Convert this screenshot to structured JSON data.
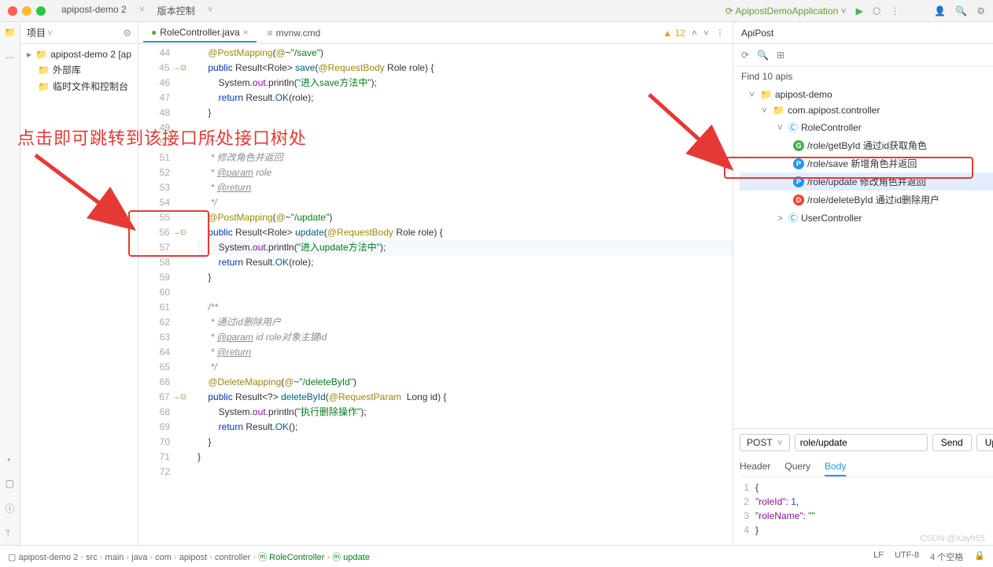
{
  "titlebar": {
    "project": "apipost-demo 2",
    "menu2": "版本控制",
    "run_config": "ApipostDemoApplication"
  },
  "project_panel": {
    "title": "项目",
    "items": [
      {
        "label": "apipost-demo 2 [ap",
        "expandable": true,
        "icon": "folder"
      },
      {
        "label": "外部库",
        "icon": "lib"
      },
      {
        "label": "临时文件和控制台",
        "icon": "scratch"
      }
    ]
  },
  "tabs": {
    "active": "RoleController.java",
    "other": "mvnw.cmd",
    "warnings": "12"
  },
  "code": {
    "lines": [
      {
        "n": 44,
        "html": "    <span class='anno'>@PostMapping</span>(<span class='anno'>@</span>~<span class='str'>\"/save\"</span>)",
        "ind": ""
      },
      {
        "n": 45,
        "html": "    <span class='kw'>public</span> Result&lt;Role&gt; <span class='fn'>save</span>(<span class='anno'>@RequestBody</span> Role role) {",
        "ind": "→⊙"
      },
      {
        "n": 46,
        "html": "        System.<span class='field'>out</span>.println(<span class='str'>\"进入save方法中\"</span>);",
        "ind": ""
      },
      {
        "n": 47,
        "html": "        <span class='kw'>return</span> Result.<span class='fn'>OK</span>(role);",
        "ind": ""
      },
      {
        "n": 48,
        "html": "    }",
        "ind": ""
      },
      {
        "n": 49,
        "html": "",
        "ind": ""
      },
      {
        "n": 50,
        "html": "    <span class='comment'>/**</span>",
        "ind": ""
      },
      {
        "n": 51,
        "html": "    <span class='comment'> * 修改角色并返回</span>",
        "ind": ""
      },
      {
        "n": 52,
        "html": "    <span class='comment'> * <span class='param'>@param</span> role</span>",
        "ind": ""
      },
      {
        "n": 53,
        "html": "    <span class='comment'> * <span class='param'>@return</span></span>",
        "ind": ""
      },
      {
        "n": 54,
        "html": "    <span class='comment'> */</span>",
        "ind": ""
      },
      {
        "n": 55,
        "html": "    <span class='anno'>@PostMapping</span>(<span class='anno'>@</span>~<span class='str'>\"/update\"</span>)",
        "ind": ""
      },
      {
        "n": 56,
        "html": "    <span class='kw'>public</span> Result&lt;Role&gt; <span class='fn'>update</span>(<span class='anno'>@RequestBody</span> Role role) {",
        "ind": "→⊙"
      },
      {
        "n": 57,
        "html": "        System.<span class='field'>out</span>.println(<span class='str'>\"进入update方法中\"</span>);",
        "ind": "",
        "hl": true
      },
      {
        "n": 58,
        "html": "        <span class='kw'>return</span> Result.<span class='fn'>OK</span>(role);",
        "ind": ""
      },
      {
        "n": 59,
        "html": "    }",
        "ind": ""
      },
      {
        "n": 60,
        "html": "",
        "ind": ""
      },
      {
        "n": 61,
        "html": "    <span class='comment'>/**</span>",
        "ind": ""
      },
      {
        "n": 62,
        "html": "    <span class='comment'> * 通过id删除用户</span>",
        "ind": ""
      },
      {
        "n": 63,
        "html": "    <span class='comment'> * <span class='param'>@param</span> id role对象主键id</span>",
        "ind": ""
      },
      {
        "n": 64,
        "html": "    <span class='comment'> * <span class='param'>@return</span></span>",
        "ind": ""
      },
      {
        "n": 65,
        "html": "    <span class='comment'> */</span>",
        "ind": ""
      },
      {
        "n": 66,
        "html": "    <span class='anno'>@DeleteMapping</span>(<span class='anno'>@</span>~<span class='str'>\"/deleteById\"</span>)",
        "ind": ""
      },
      {
        "n": 67,
        "html": "    <span class='kw'>public</span> Result&lt;?&gt; <span class='fn'>deleteById</span>(<span class='anno'>@RequestParam</span>  Long id) {",
        "ind": "→⊙"
      },
      {
        "n": 68,
        "html": "        System.<span class='field'>out</span>.println(<span class='str'>\"执行删除操作\"</span>);",
        "ind": ""
      },
      {
        "n": 69,
        "html": "        <span class='kw'>return</span> Result.<span class='fn'>OK</span>();",
        "ind": ""
      },
      {
        "n": 70,
        "html": "    }",
        "ind": ""
      },
      {
        "n": 71,
        "html": "}",
        "ind": ""
      },
      {
        "n": 72,
        "html": "",
        "ind": ""
      }
    ]
  },
  "apipost": {
    "title": "ApiPost",
    "find_label": "Find 10 apis",
    "tree": [
      {
        "lvl": 1,
        "icon": "folder",
        "label": "apipost-demo",
        "caret": "v"
      },
      {
        "lvl": 2,
        "icon": "folder",
        "label": "com.apipost.controller",
        "caret": "v"
      },
      {
        "lvl": 3,
        "icon": "class",
        "label": "RoleController",
        "caret": "v"
      },
      {
        "lvl": 4,
        "badge": "G",
        "label": "/role/getById  通过id获取角色"
      },
      {
        "lvl": 4,
        "badge": "P",
        "label": "/role/save  新增角色并返回"
      },
      {
        "lvl": 4,
        "badge": "P",
        "label": "/role/update  修改角色并返回",
        "selected": true
      },
      {
        "lvl": 4,
        "badge": "D",
        "label": "/role/deleteById  通过id删除用户"
      },
      {
        "lvl": 3,
        "icon": "class",
        "label": "UserController",
        "caret": ">"
      }
    ],
    "request": {
      "method": "POST",
      "url": "role/update",
      "send": "Send",
      "upload": "Upload",
      "tabs": [
        "Header",
        "Query",
        "Body"
      ],
      "active_tab": "Body",
      "body_lines": [
        {
          "n": 1,
          "html": "{"
        },
        {
          "n": 2,
          "html": "  <span class='jkey'>\"roleId\"</span>: <span class='jnum'>1</span>,"
        },
        {
          "n": 3,
          "html": "  <span class='jkey'>\"roleName\"</span>: <span class='jstr'>\"\"</span>"
        },
        {
          "n": 4,
          "html": "}"
        }
      ]
    }
  },
  "breadcrumbs": [
    "apipost-demo 2",
    "src",
    "main",
    "java",
    "com",
    "apipost",
    "controller",
    "RoleController",
    "update"
  ],
  "status_right": {
    "lf": "LF",
    "enc": "UTF-8",
    "spaces": "4 个空格"
  },
  "annotation": "点击即可跳转到该接口所处接口树处",
  "watermark": "CSDN @Xayh55"
}
